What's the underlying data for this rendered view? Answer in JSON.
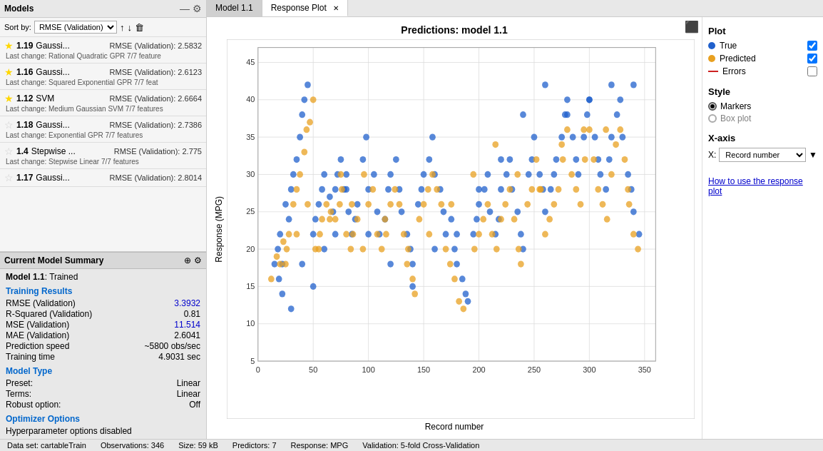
{
  "models_header": {
    "title": "Models"
  },
  "sortby": {
    "label": "Sort by:",
    "value": "RMSE (Validation)"
  },
  "models": [
    {
      "rank": "1.19",
      "name": "Gaussi...",
      "rmse_label": "RMSE (Validation):",
      "rmse_value": "2.5832",
      "last_change": "Last change: Rational Quadratic GPR  7/7 feature",
      "starred": true
    },
    {
      "rank": "1.16",
      "name": "Gaussi...",
      "rmse_label": "RMSE (Validation):",
      "rmse_value": "2.6123",
      "last_change": "Last change: Squared Exponential GPR  7/7 feat",
      "starred": true
    },
    {
      "rank": "1.12",
      "name": "SVM",
      "rmse_label": "RMSE (Validation):",
      "rmse_value": "2.6664",
      "last_change": "Last change: Medium Gaussian SVM  7/7 features",
      "starred": true
    },
    {
      "rank": "1.18",
      "name": "Gaussi...",
      "rmse_label": "RMSE (Validation):",
      "rmse_value": "2.7386",
      "last_change": "Last change: Exponential GPR   7/7 features",
      "starred": false
    },
    {
      "rank": "1.4",
      "name": "Stepwise ...",
      "rmse_label": "RMSE (Validation):",
      "rmse_value": "2.775",
      "last_change": "Last change: Stepwise Linear   7/7 features",
      "starred": false
    },
    {
      "rank": "1.17",
      "name": "Gaussi...",
      "rmse_label": "RMSE (Validation):",
      "rmse_value": "2.8014",
      "last_change": "",
      "starred": false
    }
  ],
  "current_model_section": {
    "title": "Current Model Summary",
    "model_id": "Model 1.1",
    "status": "Trained",
    "training_results_title": "Training Results",
    "metrics": [
      {
        "label": "RMSE (Validation)",
        "value": "3.3932",
        "blue": true
      },
      {
        "label": "R-Squared (Validation)",
        "value": "0.81",
        "blue": false
      },
      {
        "label": "MSE (Validation)",
        "value": "11.514",
        "blue": true
      },
      {
        "label": "MAE (Validation)",
        "value": "2.6041",
        "blue": false
      },
      {
        "label": "Prediction speed",
        "value": "~5800 obs/sec",
        "blue": false
      },
      {
        "label": "Training time",
        "value": "4.9031 sec",
        "blue": false
      }
    ],
    "model_type_title": "Model Type",
    "model_type": [
      {
        "label": "Preset:",
        "value": "Linear"
      },
      {
        "label": "Terms:",
        "value": "Linear"
      },
      {
        "label": "Robust option:",
        "value": "Off"
      }
    ],
    "optimizer_title": "Optimizer Options",
    "optimizer_text": "Hyperparameter options disabled"
  },
  "tab_model": "Model 1.1",
  "tab_response": "Response Plot",
  "chart": {
    "title": "Predictions: model 1.1",
    "x_label": "Record number",
    "y_label": "Response (MPG)",
    "y_min": 5,
    "y_max": 45,
    "x_min": 0,
    "x_max": 350
  },
  "plot_controls": {
    "section_title": "Plot",
    "true_label": "True",
    "predicted_label": "Predicted",
    "errors_label": "Errors",
    "true_checked": true,
    "predicted_checked": true,
    "errors_checked": false
  },
  "style_controls": {
    "section_title": "Style",
    "markers_label": "Markers",
    "boxplot_label": "Box plot",
    "markers_selected": true
  },
  "xaxis_controls": {
    "section_title": "X-axis",
    "x_label": "X:",
    "x_value": "Record number"
  },
  "howto_link": "How to use the response plot",
  "status_bar": {
    "dataset": "Data set: cartableTrain",
    "observations": "Observations: 346",
    "size": "Size: 59 kB",
    "predictors": "Predictors: 7",
    "response": "Response: MPG",
    "validation": "Validation: 5-fold Cross-Validation"
  },
  "scatter_data": {
    "blue_points": [
      [
        15,
        18
      ],
      [
        18,
        20
      ],
      [
        19,
        16
      ],
      [
        20,
        22
      ],
      [
        22,
        18
      ],
      [
        25,
        26
      ],
      [
        28,
        24
      ],
      [
        30,
        28
      ],
      [
        32,
        30
      ],
      [
        35,
        32
      ],
      [
        38,
        35
      ],
      [
        40,
        38
      ],
      [
        42,
        40
      ],
      [
        45,
        42
      ],
      [
        50,
        22
      ],
      [
        52,
        24
      ],
      [
        55,
        26
      ],
      [
        58,
        28
      ],
      [
        60,
        30
      ],
      [
        65,
        27
      ],
      [
        68,
        25
      ],
      [
        70,
        28
      ],
      [
        72,
        30
      ],
      [
        75,
        32
      ],
      [
        78,
        28
      ],
      [
        80,
        30
      ],
      [
        82,
        25
      ],
      [
        85,
        22
      ],
      [
        88,
        24
      ],
      [
        90,
        26
      ],
      [
        95,
        32
      ],
      [
        98,
        35
      ],
      [
        100,
        28
      ],
      [
        105,
        30
      ],
      [
        108,
        25
      ],
      [
        110,
        22
      ],
      [
        115,
        24
      ],
      [
        118,
        28
      ],
      [
        120,
        30
      ],
      [
        125,
        32
      ],
      [
        128,
        28
      ],
      [
        130,
        25
      ],
      [
        135,
        22
      ],
      [
        138,
        20
      ],
      [
        140,
        18
      ],
      [
        145,
        26
      ],
      [
        148,
        28
      ],
      [
        150,
        30
      ],
      [
        155,
        32
      ],
      [
        158,
        35
      ],
      [
        160,
        30
      ],
      [
        165,
        28
      ],
      [
        168,
        25
      ],
      [
        170,
        22
      ],
      [
        175,
        24
      ],
      [
        178,
        20
      ],
      [
        180,
        18
      ],
      [
        185,
        16
      ],
      [
        188,
        14
      ],
      [
        190,
        13
      ],
      [
        195,
        22
      ],
      [
        198,
        24
      ],
      [
        200,
        26
      ],
      [
        205,
        28
      ],
      [
        208,
        30
      ],
      [
        210,
        25
      ],
      [
        215,
        22
      ],
      [
        218,
        24
      ],
      [
        220,
        28
      ],
      [
        225,
        30
      ],
      [
        228,
        32
      ],
      [
        230,
        28
      ],
      [
        235,
        25
      ],
      [
        238,
        22
      ],
      [
        240,
        20
      ],
      [
        245,
        30
      ],
      [
        248,
        32
      ],
      [
        250,
        35
      ],
      [
        255,
        30
      ],
      [
        258,
        28
      ],
      [
        260,
        25
      ],
      [
        265,
        28
      ],
      [
        268,
        30
      ],
      [
        270,
        32
      ],
      [
        275,
        35
      ],
      [
        278,
        38
      ],
      [
        280,
        40
      ],
      [
        285,
        35
      ],
      [
        288,
        32
      ],
      [
        290,
        30
      ],
      [
        295,
        35
      ],
      [
        298,
        38
      ],
      [
        300,
        40
      ],
      [
        305,
        35
      ],
      [
        308,
        32
      ],
      [
        310,
        30
      ],
      [
        315,
        28
      ],
      [
        318,
        32
      ],
      [
        320,
        35
      ],
      [
        325,
        38
      ],
      [
        328,
        40
      ],
      [
        330,
        35
      ],
      [
        335,
        30
      ],
      [
        338,
        28
      ],
      [
        340,
        25
      ],
      [
        345,
        22
      ],
      [
        22,
        14
      ],
      [
        30,
        12
      ],
      [
        40,
        18
      ],
      [
        50,
        15
      ],
      [
        60,
        20
      ],
      [
        70,
        22
      ],
      [
        80,
        28
      ],
      [
        100,
        22
      ],
      [
        120,
        18
      ],
      [
        140,
        15
      ],
      [
        160,
        20
      ],
      [
        180,
        22
      ],
      [
        200,
        28
      ],
      [
        220,
        32
      ],
      [
        240,
        38
      ],
      [
        260,
        42
      ],
      [
        280,
        38
      ],
      [
        300,
        40
      ],
      [
        320,
        42
      ],
      [
        340,
        42
      ]
    ],
    "orange_points": [
      [
        12,
        16
      ],
      [
        17,
        19
      ],
      [
        20,
        18
      ],
      [
        23,
        21
      ],
      [
        26,
        20
      ],
      [
        28,
        22
      ],
      [
        32,
        26
      ],
      [
        35,
        28
      ],
      [
        38,
        30
      ],
      [
        42,
        33
      ],
      [
        44,
        36
      ],
      [
        47,
        37
      ],
      [
        50,
        40
      ],
      [
        52,
        20
      ],
      [
        56,
        22
      ],
      [
        58,
        24
      ],
      [
        62,
        26
      ],
      [
        66,
        25
      ],
      [
        70,
        24
      ],
      [
        74,
        26
      ],
      [
        76,
        28
      ],
      [
        80,
        22
      ],
      [
        84,
        20
      ],
      [
        86,
        22
      ],
      [
        90,
        24
      ],
      [
        96,
        30
      ],
      [
        100,
        26
      ],
      [
        104,
        28
      ],
      [
        108,
        22
      ],
      [
        112,
        20
      ],
      [
        116,
        22
      ],
      [
        120,
        26
      ],
      [
        124,
        28
      ],
      [
        128,
        26
      ],
      [
        132,
        22
      ],
      [
        136,
        20
      ],
      [
        140,
        16
      ],
      [
        142,
        14
      ],
      [
        146,
        24
      ],
      [
        150,
        26
      ],
      [
        154,
        28
      ],
      [
        158,
        30
      ],
      [
        162,
        28
      ],
      [
        166,
        26
      ],
      [
        170,
        20
      ],
      [
        174,
        18
      ],
      [
        178,
        16
      ],
      [
        182,
        13
      ],
      [
        186,
        12
      ],
      [
        196,
        20
      ],
      [
        200,
        22
      ],
      [
        204,
        24
      ],
      [
        208,
        26
      ],
      [
        212,
        22
      ],
      [
        216,
        20
      ],
      [
        220,
        24
      ],
      [
        224,
        26
      ],
      [
        228,
        28
      ],
      [
        232,
        24
      ],
      [
        236,
        20
      ],
      [
        238,
        18
      ],
      [
        244,
        26
      ],
      [
        248,
        28
      ],
      [
        252,
        32
      ],
      [
        256,
        28
      ],
      [
        260,
        22
      ],
      [
        264,
        24
      ],
      [
        268,
        26
      ],
      [
        272,
        28
      ],
      [
        276,
        32
      ],
      [
        280,
        36
      ],
      [
        284,
        30
      ],
      [
        288,
        28
      ],
      [
        292,
        26
      ],
      [
        296,
        32
      ],
      [
        300,
        36
      ],
      [
        304,
        32
      ],
      [
        308,
        28
      ],
      [
        312,
        26
      ],
      [
        316,
        24
      ],
      [
        320,
        30
      ],
      [
        324,
        34
      ],
      [
        328,
        36
      ],
      [
        332,
        32
      ],
      [
        336,
        26
      ],
      [
        340,
        22
      ],
      [
        344,
        20
      ],
      [
        25,
        18
      ],
      [
        35,
        22
      ],
      [
        45,
        26
      ],
      [
        55,
        20
      ],
      [
        65,
        24
      ],
      [
        75,
        30
      ],
      [
        85,
        26
      ],
      [
        95,
        20
      ],
      [
        115,
        24
      ],
      [
        135,
        18
      ],
      [
        155,
        22
      ],
      [
        175,
        26
      ],
      [
        195,
        30
      ],
      [
        215,
        34
      ],
      [
        235,
        30
      ],
      [
        255,
        28
      ],
      [
        275,
        34
      ],
      [
        295,
        36
      ],
      [
        315,
        36
      ],
      [
        335,
        28
      ]
    ]
  }
}
